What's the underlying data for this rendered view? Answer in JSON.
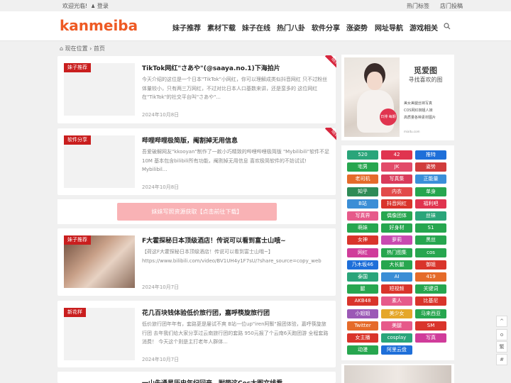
{
  "topbar": {
    "welcome": "欢迎光临!",
    "login": "登录",
    "hot_tags": "热门标签",
    "submit": "店门投稿"
  },
  "logo": "kanmeiba",
  "nav": [
    "妹子推荐",
    "素材下载",
    "妹子在线",
    "热门八卦",
    "软件分享",
    "涨姿势",
    "网址导航",
    "游戏相关"
  ],
  "breadcrumb": {
    "prefix": "现在位置",
    "home": "首页"
  },
  "posts": [
    {
      "tag": "妹子推荐",
      "title": "TikTok网红\"さあや\"(@saaya.no.1)下海拍片",
      "desc": "今天介绍的这位是一个日本\"TikTok\"小网红，你可以理解成类似抖音网红 只不过粉丝体量较小，只有两三万网红，不过对比日本人口基数来讲，还是蛮多的 这位网红在\"TikTok\"的社交平台叫\"さあや\"...",
      "date": "2024年10月8日",
      "ribbon": "NEW"
    },
    {
      "tag": "软件分享",
      "title": "哔哩哔哩极简版，阉割掉无用信息",
      "desc": "吾爱破解网友\"kkooyan\"制作了一款小巧精致的哔哩哔哩极简版 \"Mybilibili\"软件不足10M 基本包含bilibili所有功能，阉割掉无用信息 喜欢极简软件的不妨试试! Mybilibil...",
      "date": "2024年10月8日",
      "ribbon": "NEW"
    },
    {
      "tag": "妹子推荐",
      "title": "F大霍探秘日本顶级酒店！传说可以看到富士山哦~",
      "desc": "【荷这F大霍探秘日本顶级酒店！传说可以看到富士山哦~】 https://www.bilibili.com/video/BV1UH4y1F7sU/?share_source=copy_web",
      "date": "2024年10月7日",
      "ribbon": ""
    },
    {
      "tag": "新花样",
      "title": "花几百块钱体验低价旅行团，嘉呼筷旋旅行团",
      "desc": "低价旅行团年年有，套路更是屡试不爽 B站一位up\"iren阿鬃\"报团体验，嘉呼筷旋旅行团 去年我们给大家分享过云南旅行团的套路 950元报了个云南6天跑团游 全程套路消费！ 今天这个则是主打老年人群体...",
      "date": "2024年10月7日",
      "ribbon": ""
    },
    {
      "tag": "",
      "title": "一山先通星历史年纪回来，附带这Ces大图文线看",
      "desc": "",
      "date": "",
      "ribbon": ""
    }
  ],
  "download_banner": "妹妹写照资源获取【点击前往下载】",
  "side_ad": {
    "title": "觅爱图",
    "subtitle": "寻找喜欢的图",
    "bullets": [
      "美女美腿丝袜写真",
      "COS网红御姐人妹",
      "高质量各种素材图片"
    ],
    "badge": "日排 每期",
    "footer": "miaitu.com"
  },
  "tags": [
    {
      "label": "520",
      "color": "#2aa57a"
    },
    {
      "label": "42",
      "color": "#e0344f"
    },
    {
      "label": "推特",
      "color": "#1e6fd9"
    },
    {
      "label": "宅男",
      "color": "#27a64f"
    },
    {
      "label": "JK",
      "color": "#e24b6a"
    },
    {
      "label": "姿势",
      "color": "#d03c3c"
    },
    {
      "label": "老司机",
      "color": "#e56b2a"
    },
    {
      "label": "写真集",
      "color": "#d93a5a"
    },
    {
      "label": "正能量",
      "color": "#3a8fd9"
    },
    {
      "label": "知乎",
      "color": "#2e8b57"
    },
    {
      "label": "内衣",
      "color": "#e24a4a"
    },
    {
      "label": "单身",
      "color": "#27a64f"
    },
    {
      "label": "B站",
      "color": "#3b8ed6"
    },
    {
      "label": "抖音网红",
      "color": "#d9342b"
    },
    {
      "label": "福利吧",
      "color": "#e0344f"
    },
    {
      "label": "写真界",
      "color": "#e65a8a"
    },
    {
      "label": "偶像团体",
      "color": "#27a64f"
    },
    {
      "label": "丝袜",
      "color": "#2aa57a"
    },
    {
      "label": "萌妹",
      "color": "#27a64f"
    },
    {
      "label": "好身材",
      "color": "#27a64f"
    },
    {
      "label": "S1",
      "color": "#27a64f"
    },
    {
      "label": "女神",
      "color": "#d9342b"
    },
    {
      "label": "萝莉",
      "color": "#c94ab0"
    },
    {
      "label": "黑丝",
      "color": "#27a64f"
    },
    {
      "label": "网红",
      "color": "#d03c9a"
    },
    {
      "label": "热门图集",
      "color": "#27a64f"
    },
    {
      "label": "cos",
      "color": "#27a64f"
    },
    {
      "label": "乃木坂46",
      "color": "#1e6fd9"
    },
    {
      "label": "大长腿",
      "color": "#27a64f"
    },
    {
      "label": "御姐",
      "color": "#d9342b"
    },
    {
      "label": "泰国",
      "color": "#2aa57a"
    },
    {
      "label": "AI",
      "color": "#3b8ed6"
    },
    {
      "label": "419",
      "color": "#e56b2a"
    },
    {
      "label": "腿",
      "color": "#27a64f"
    },
    {
      "label": "短视频",
      "color": "#d9342b"
    },
    {
      "label": "关键词",
      "color": "#27a64f"
    },
    {
      "label": "AKB48",
      "color": "#d9342b"
    },
    {
      "label": "素人",
      "color": "#e65a8a"
    },
    {
      "label": "比基尼",
      "color": "#d9342b"
    },
    {
      "label": "小姐姐",
      "color": "#9b59b6"
    },
    {
      "label": "美少女",
      "color": "#e5a72a"
    },
    {
      "label": "马来西亚",
      "color": "#27a64f"
    },
    {
      "label": "Twitter",
      "color": "#e56b2a"
    },
    {
      "label": "美腿",
      "color": "#e65a8a"
    },
    {
      "label": "SM",
      "color": "#d9342b"
    },
    {
      "label": "女主播",
      "color": "#d9342b"
    },
    {
      "label": "cosplay",
      "color": "#2aa57a"
    },
    {
      "label": "写真",
      "color": "#d03c9a"
    },
    {
      "label": "动漫",
      "color": "#27a64f"
    },
    {
      "label": "阿里云盘",
      "color": "#1e6fd9"
    }
  ],
  "float_buttons": {
    "up": "^",
    "chat": "o",
    "trad": "繁",
    "qr": "#"
  }
}
